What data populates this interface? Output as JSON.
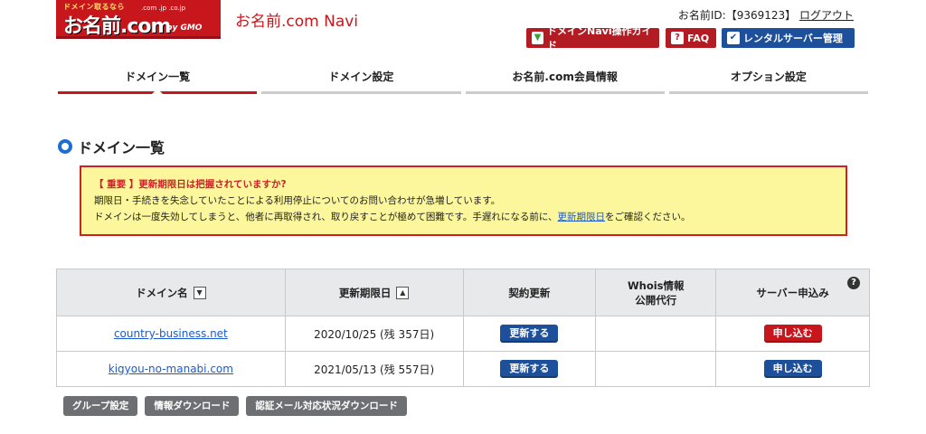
{
  "logo": {
    "tagline": "ドメイン取るなら",
    "brand": "お名前.com",
    "tlds": ".com .jp .co.jp",
    "gmo": "by GMO"
  },
  "header": {
    "app_title": "お名前.com Navi",
    "account_label": "お名前ID:【9369123】",
    "logout_label": "ログアウト",
    "buttons": {
      "guide": "ドメインNavi操作ガイド",
      "faq": "FAQ",
      "rental": "レンタルサーバー管理"
    }
  },
  "tabs": [
    {
      "label": "ドメイン一覧",
      "active": true
    },
    {
      "label": "ドメイン設定",
      "active": false
    },
    {
      "label": "お名前.com会員情報",
      "active": false
    },
    {
      "label": "オプション設定",
      "active": false
    }
  ],
  "section": {
    "title": "ドメイン一覧"
  },
  "alert": {
    "heading": "【 重要 】更新期限日は把握されていますか?",
    "line1": "期限日・手続きを失念していたことによる利用停止についてのお問い合わせが急増しています。",
    "line2_before": "ドメインは一度失効してしまうと、他者に再取得され、取り戻すことが極めて困難です。手遅れになる前に、",
    "line2_link": "更新期限日",
    "line2_after": "をご確認ください。"
  },
  "table": {
    "headers": {
      "domain": "ドメイン名",
      "expiry": "更新期限日",
      "renew": "契約更新",
      "whois_line1": "Whois情報",
      "whois_line2": "公開代行",
      "server": "サーバー申込み"
    },
    "rows": [
      {
        "domain": "country-business.net",
        "expiry": "2020/10/25 (残 357日)",
        "renew": "更新する",
        "whois": "",
        "server": "申し込む",
        "server_color": "#c8161d"
      },
      {
        "domain": "kigyou-no-manabi.com",
        "expiry": "2021/05/13 (残 557日)",
        "renew": "更新する",
        "whois": "",
        "server": "申し込む",
        "server_color": "#1d4f9a"
      }
    ]
  },
  "bottom_buttons": {
    "group": "グループ設定",
    "download": "情報ダウンロード",
    "auth_download": "認証メール対応状況ダウンロード"
  },
  "icons": {
    "guide": "beginner-leaf-icon",
    "faq": "question-icon",
    "rental": "server-check-icon",
    "help": "help-icon",
    "sort_down": "sort-desc-icon",
    "sort_up": "sort-asc-icon"
  },
  "colors": {
    "brand_red": "#c8161d",
    "brand_blue": "#1d4f9a",
    "alert_bg": "#fcf79c",
    "link": "#1a5bd1"
  }
}
